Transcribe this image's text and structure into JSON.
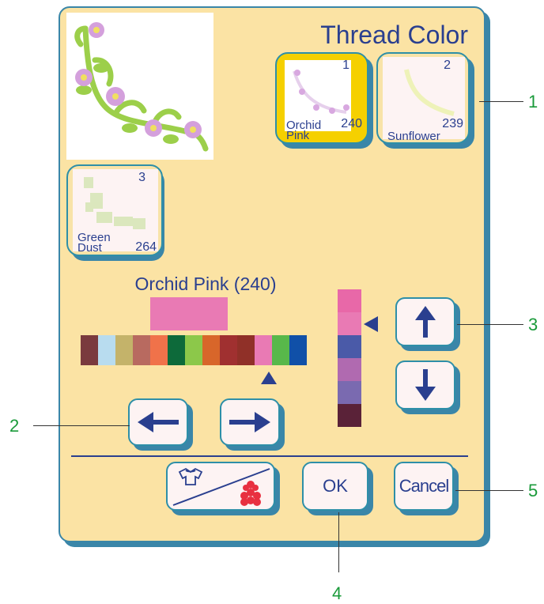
{
  "title": "Thread Color",
  "threads": [
    {
      "order": "1",
      "code": "240",
      "name_line1": "Orchid",
      "name_line2": "Pink",
      "selected": true
    },
    {
      "order": "2",
      "code": "239",
      "name": "Sunflower",
      "selected": false
    },
    {
      "order": "3",
      "code": "264",
      "name_line1": "Green",
      "name_line2": "Dust",
      "selected": false
    }
  ],
  "current_color": {
    "label": "Orchid Pink (240)",
    "swatch": "#e97ab4"
  },
  "palette_horizontal": [
    "#7a3a3e",
    "#b8dcef",
    "#c4b36a",
    "#b86a60",
    "#f0724a",
    "#0d6a3a",
    "#8cc84a",
    "#d8662a",
    "#a03030",
    "#903028",
    "#e97ab4",
    "#58b84a",
    "#1050a8"
  ],
  "palette_horizontal_selected_index": 10,
  "palette_vertical": [
    "#e868a8",
    "#e97ab4",
    "#4a5aa8",
    "#b06ab0",
    "#7a6ab0",
    "#5a2238"
  ],
  "palette_vertical_selected_index": 1,
  "buttons": {
    "up": "up-arrow-icon",
    "down": "down-arrow-icon",
    "left": "left-arrow-icon",
    "right": "right-arrow-icon",
    "view_toggle": "garment-flower-toggle-icon",
    "ok": "OK",
    "cancel": "Cancel"
  },
  "callouts": {
    "c1": "1",
    "c2": "2",
    "c3": "3",
    "c4": "4",
    "c5": "5"
  },
  "colors": {
    "panel": "#fbe3a4",
    "border": "#3a86a8",
    "text": "#2a3f8f",
    "callout": "#1a9a3a",
    "selected_tile": "#f5d000"
  }
}
